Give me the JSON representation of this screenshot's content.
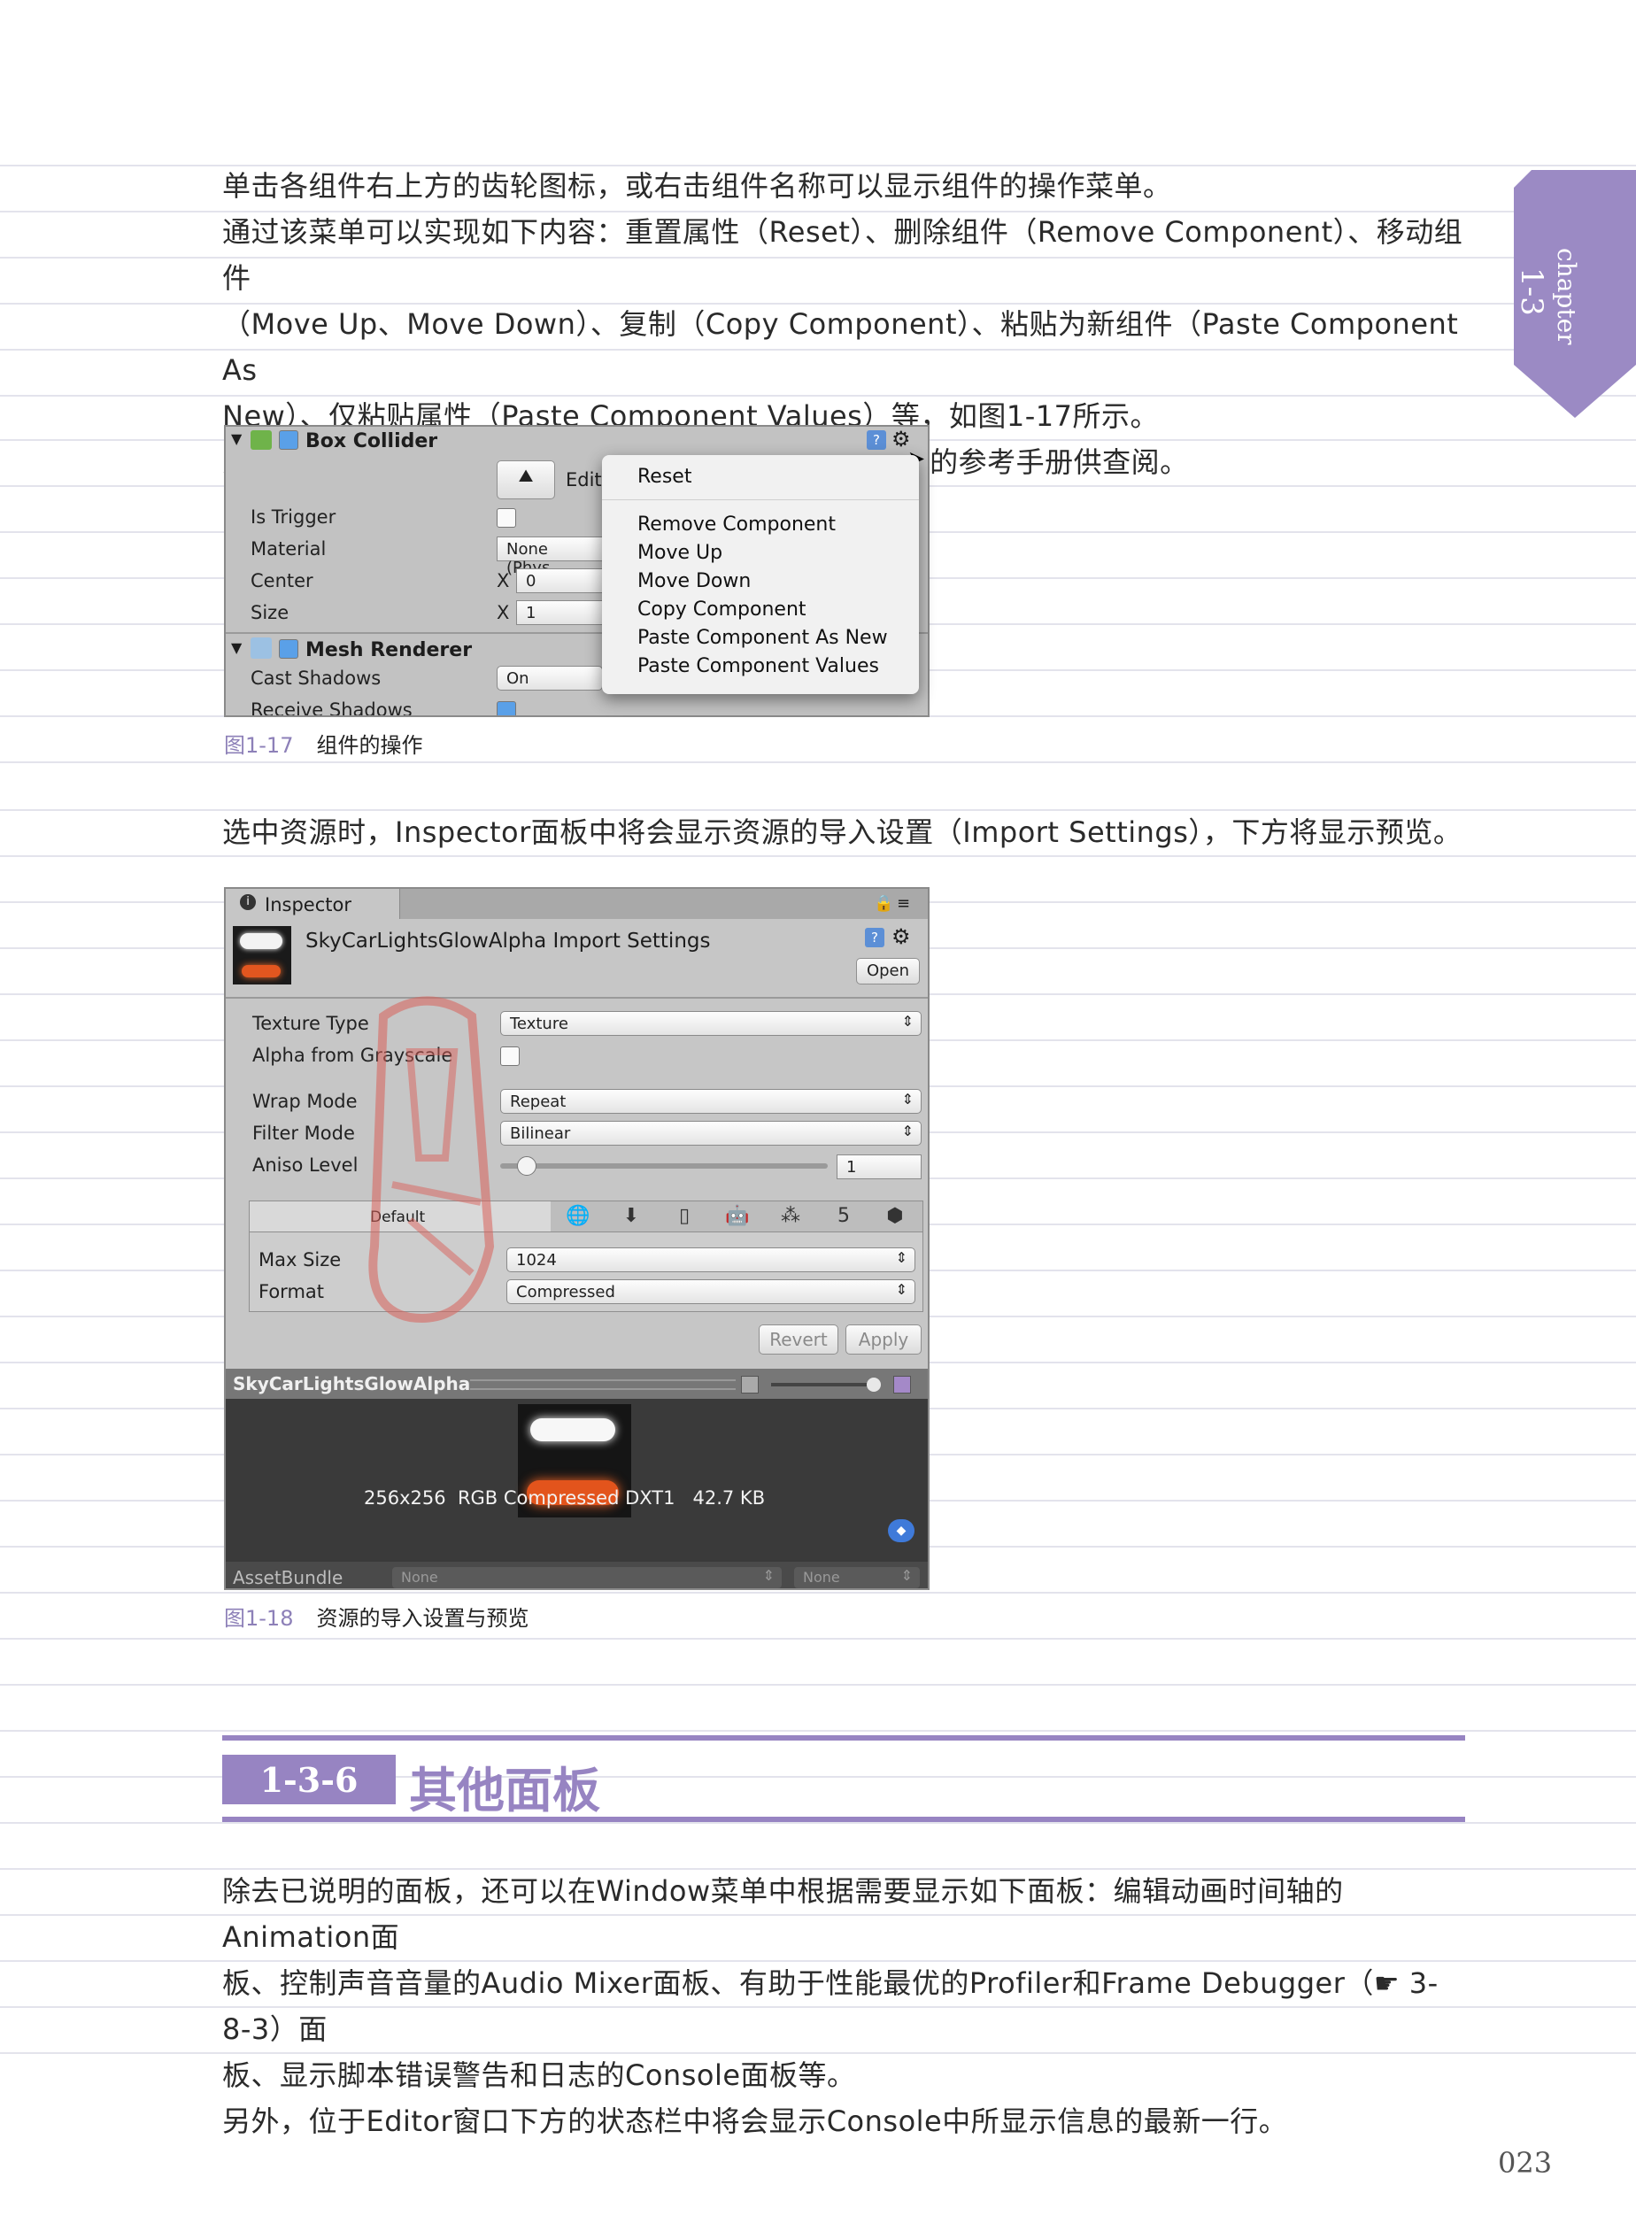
{
  "side_tab": {
    "line1": "chapter",
    "line2": "1-3",
    "color": "#9b8ac4"
  },
  "intro": {
    "lines": [
      "单击各组件右上方的齿轮图标，或右击组件名称可以显示组件的操作菜单。",
      "通过该菜单可以实现如下内容：重置属性（Reset）、删除组件（Remove Component）、移动组件",
      "（Move Up、Move Down）、复制（Copy Component）、粘贴为新组件（Paste Component As",
      "New）、仅粘贴属性（Paste Component Values）等，如图1-17所示。",
      "另外，单击齿轮图标左侧的“?”标记，会出现关于该组件的参考手册供查阅。"
    ]
  },
  "fig17": {
    "box_collider": "Box Collider",
    "edit": "Edit",
    "rows": [
      "Is Trigger",
      "Material",
      "Center",
      "Size"
    ],
    "material_value": "None (Phys",
    "x_label": "X",
    "center_x": "0",
    "size_x": "1",
    "mesh_renderer": "Mesh Renderer",
    "cast_shadows": "Cast Shadows",
    "cast_value": "On",
    "receive_shadows": "Receive Shadows",
    "menu": {
      "reset": "Reset",
      "items": [
        "Remove Component",
        "Move Up",
        "Move Down",
        "Copy Component",
        "Paste Component As New",
        "Paste Component Values"
      ]
    },
    "caption_num": "图1-17",
    "caption_text": "组件的操作"
  },
  "mid_text": "选中资源时，Inspector面板中将会显示资源的导入设置（Import Settings），下方将显示预览。",
  "fig18": {
    "tab_label": "Inspector",
    "title": "SkyCarLightsGlowAlpha Import Settings",
    "open": "Open",
    "texture_type": {
      "label": "Texture Type",
      "value": "Texture"
    },
    "alpha_gray": "Alpha from Grayscale",
    "wrap_mode": {
      "label": "Wrap Mode",
      "value": "Repeat"
    },
    "filter_mode": {
      "label": "Filter Mode",
      "value": "Bilinear"
    },
    "aniso": {
      "label": "Aniso Level",
      "value": "1",
      "level_fraction": 0.05
    },
    "default_tab": "Default",
    "platform_icons": [
      "globe-icon",
      "download-icon",
      "phone-icon",
      "android-icon",
      "blackberry-icon",
      "html5-icon",
      "box-icon"
    ],
    "max_size": {
      "label": "Max Size",
      "value": "1024"
    },
    "format": {
      "label": "Format",
      "value": "Compressed"
    },
    "revert": "Revert",
    "apply": "Apply",
    "preview_name": "SkyCarLightsGlowAlpha",
    "preview_info": "256x256  RGB Compressed DXT1   42.7 KB",
    "asset_bundle": "AssetBundle",
    "none1": "None",
    "none2": "None",
    "caption_num": "图1-18",
    "caption_text": "资源的导入设置与预览"
  },
  "section": {
    "num": "1-3-6",
    "title": "其他面板"
  },
  "outro": {
    "lines": [
      "除去已说明的面板，还可以在Window菜单中根据需要显示如下面板：编辑动画时间轴的Animation面",
      "板、控制声音音量的Audio Mixer面板、有助于性能最优的Profiler和Frame Debugger（☛ 3-8-3）面",
      "板、显示脚本错误警告和日志的Console面板等。",
      "另外，位于Editor窗口下方的状态栏中将会显示Console中所显示信息的最新一行。"
    ]
  },
  "page_number": "023"
}
